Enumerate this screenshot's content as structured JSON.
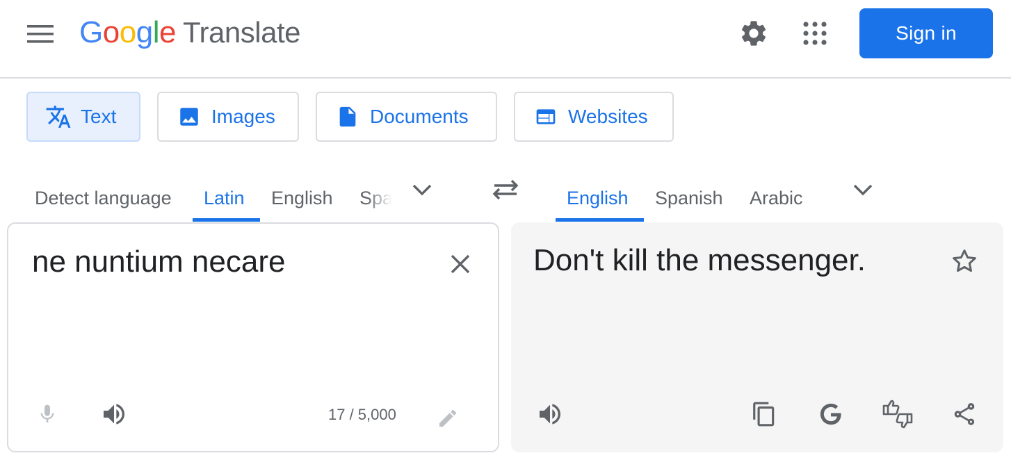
{
  "header": {
    "logo_letters": [
      "G",
      "o",
      "o",
      "g",
      "l",
      "e"
    ],
    "logo_colors": [
      "#4285f4",
      "#ea4335",
      "#fbbc05",
      "#4285f4",
      "#34a853",
      "#ea4335"
    ],
    "product_name": "Translate",
    "signin_label": "Sign in",
    "icons": [
      "menu-icon",
      "settings-gear-icon",
      "apps-grid-icon"
    ]
  },
  "modes": [
    {
      "label": "Text",
      "icon": "translate-icon",
      "active": true
    },
    {
      "label": "Images",
      "icon": "image-icon",
      "active": false
    },
    {
      "label": "Documents",
      "icon": "document-icon",
      "active": false
    },
    {
      "label": "Websites",
      "icon": "website-icon",
      "active": false
    }
  ],
  "source_languages": [
    "Detect language",
    "Latin",
    "English",
    "Spa"
  ],
  "source_active": "Latin",
  "target_languages": [
    "English",
    "Spanish",
    "Arabic"
  ],
  "target_active": "English",
  "source": {
    "text": "ne nuntium necare",
    "char_count": "17 / 5,000"
  },
  "target": {
    "text": "Don't kill the messenger."
  },
  "colors": {
    "accent": "#1a73e8",
    "text_gray": "#5f6368",
    "border": "#dadce0",
    "target_bg": "#f5f5f5",
    "active_mode_bg": "#e8f0fe"
  }
}
